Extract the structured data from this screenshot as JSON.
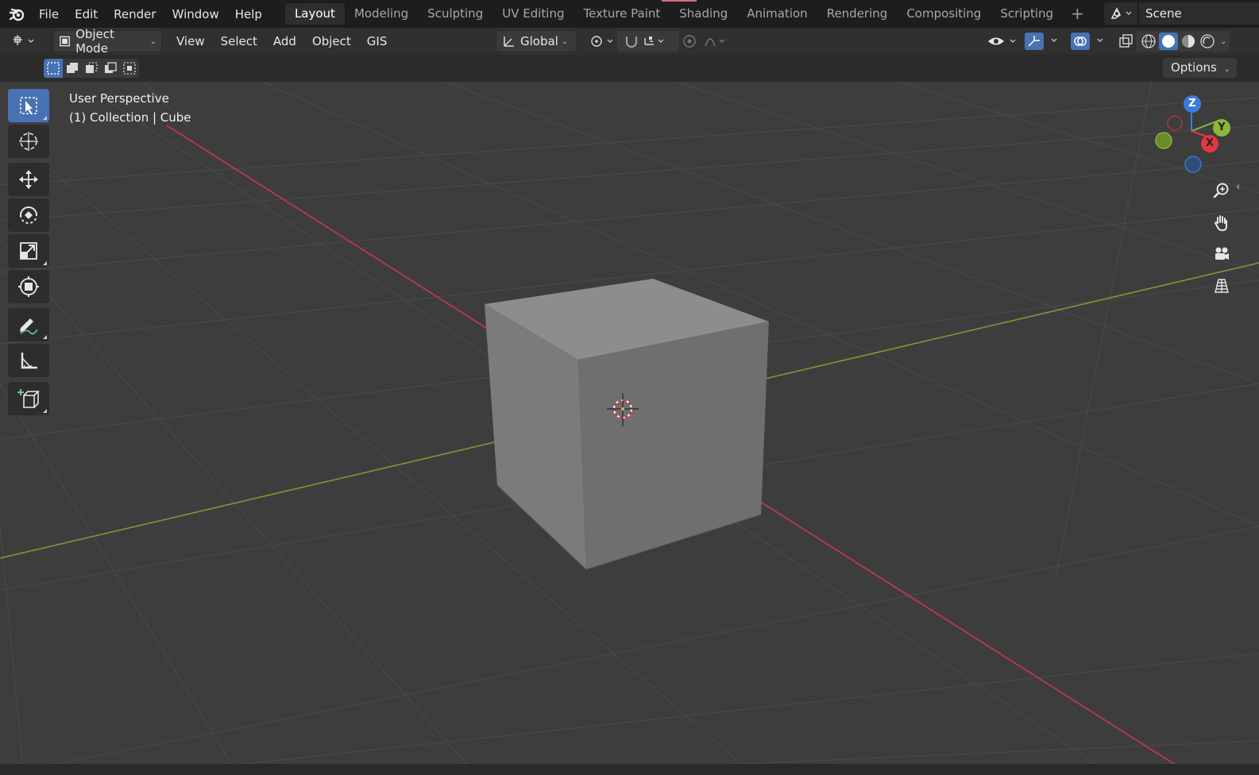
{
  "menu": {
    "items": [
      "File",
      "Edit",
      "Render",
      "Window",
      "Help"
    ]
  },
  "workspaces": {
    "tabs": [
      "Layout",
      "Modeling",
      "Sculpting",
      "UV Editing",
      "Texture Paint",
      "Shading",
      "Animation",
      "Rendering",
      "Compositing",
      "Scripting"
    ],
    "active": "Layout",
    "add_symbol": "+"
  },
  "scene": {
    "name": "Scene"
  },
  "header": {
    "mode_label": "Object Mode",
    "menus": [
      "View",
      "Select",
      "Add",
      "Object",
      "GIS"
    ],
    "transform_orientation": "Global"
  },
  "toolsettings": {
    "options_label": "Options"
  },
  "viewport": {
    "perspective_label": "User Perspective",
    "collection_label": "(1) Collection | Cube"
  },
  "gizmo": {
    "axis_z": "Z",
    "axis_y": "Y",
    "axis_x": "X"
  },
  "colors": {
    "accent": "#4772b3",
    "axis_x": "#e2383f",
    "axis_y": "#8bb73a",
    "axis_z": "#3b7dde",
    "grid": "#4a4a4a",
    "viewport_bg": "#3d3d3d"
  },
  "icons": {
    "logo": "blender-logo-icon",
    "tools": [
      "select-box-icon",
      "cursor-icon",
      "move-icon",
      "rotate-icon",
      "scale-icon",
      "transform-icon",
      "annotate-icon",
      "measure-icon",
      "add-cube-icon"
    ],
    "nav": [
      "zoom-icon",
      "hand-pan-icon",
      "camera-icon",
      "grid-perspective-icon"
    ]
  }
}
